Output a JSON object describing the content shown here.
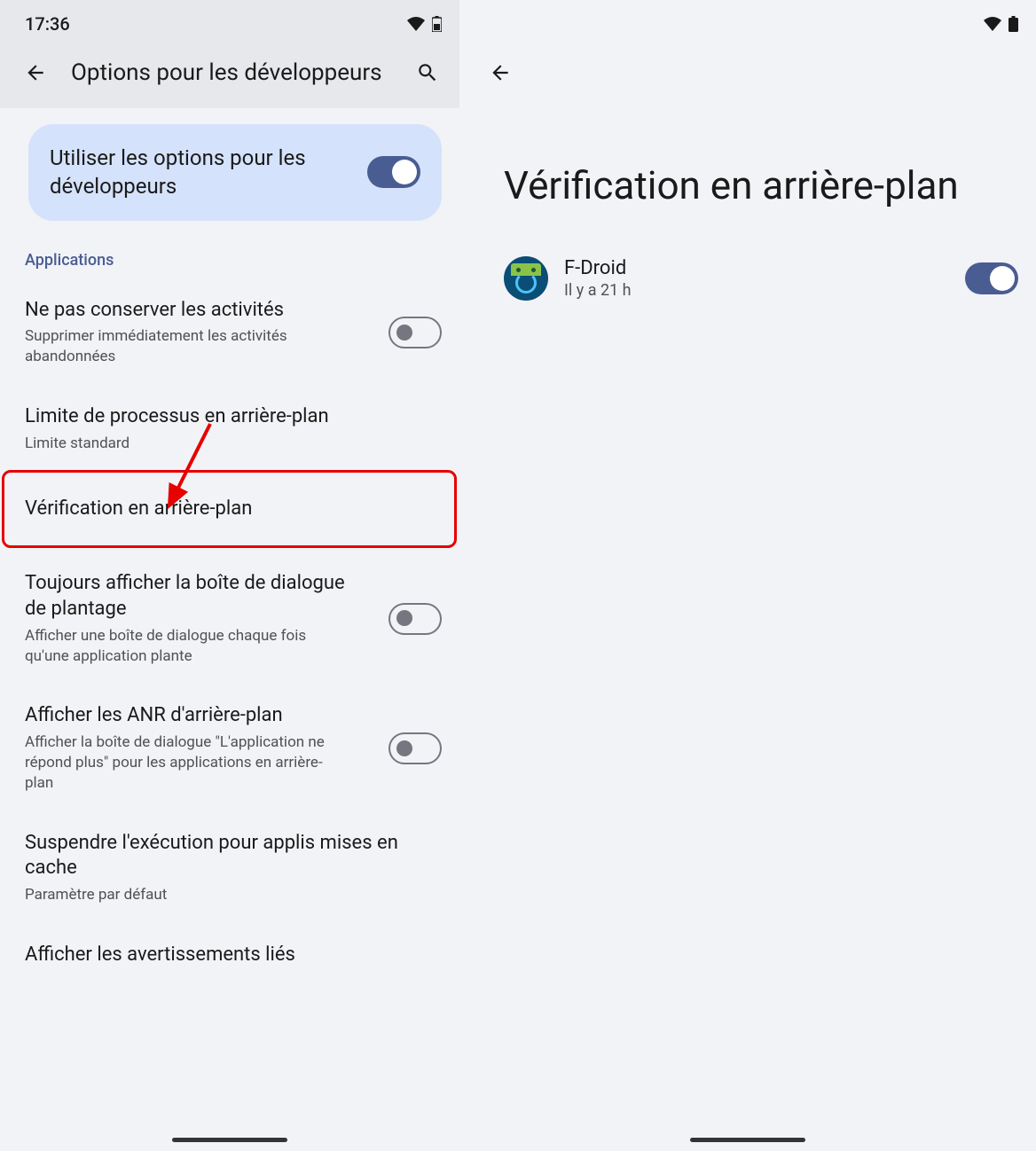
{
  "left": {
    "status": {
      "time": "17:36"
    },
    "appbar": {
      "title": "Options pour les développeurs"
    },
    "master_toggle": {
      "label": "Utiliser les options pour les développeurs",
      "on": true
    },
    "section_label": "Applications",
    "items": [
      {
        "title": "Ne pas conserver les activités",
        "desc": "Supprimer immédiatement les activités abandonnées",
        "toggle": "off"
      },
      {
        "title": "Limite de processus en arrière-plan",
        "desc": "Limite standard"
      },
      {
        "title": "Vérification en arrière-plan",
        "highlight": true
      },
      {
        "title": "Toujours afficher la boîte de dialogue de plantage",
        "desc": "Afficher une boîte de dialogue chaque fois qu'une application plante",
        "toggle": "off"
      },
      {
        "title": "Afficher les ANR d'arrière-plan",
        "desc": "Afficher la boîte de dialogue \"L'application ne répond plus\" pour les applications en arrière-plan",
        "toggle": "off"
      },
      {
        "title": "Suspendre l'exécution pour applis mises en cache",
        "desc": "Paramètre par défaut"
      },
      {
        "title": "Afficher les avertissements liés"
      }
    ]
  },
  "right": {
    "title": "Vérification en arrière-plan",
    "app": {
      "name": "F-Droid",
      "meta": "Il y a 21 h",
      "toggle": "on"
    }
  }
}
